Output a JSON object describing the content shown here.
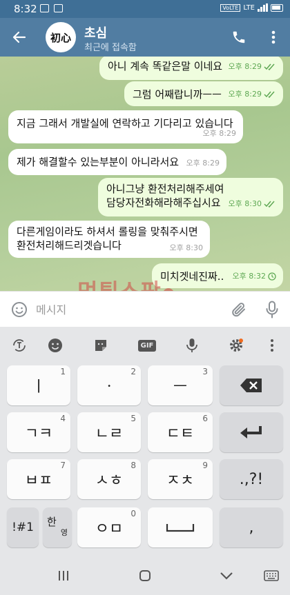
{
  "status_bar": {
    "time": "8:32",
    "network": "LTE"
  },
  "header": {
    "title": "초심",
    "subtitle": "최근에 접속함",
    "avatar_text": "初心"
  },
  "messages": [
    {
      "dir": "out",
      "text": "아니 계속 똑같은말 이네요",
      "time": "오후 8:29",
      "status": "read"
    },
    {
      "dir": "out",
      "text": "그럼 어째랍니까ㅡㅡ",
      "time": "오후 8:29",
      "status": "read"
    },
    {
      "dir": "in",
      "text": "지금 그래서 개발실에 연락하고 기다리고 있습니다",
      "time": "오후 8:29"
    },
    {
      "dir": "in",
      "text": "제가 해결할수 있는부분이 아니라서요",
      "time": "오후 8:29"
    },
    {
      "dir": "out",
      "lines": [
        "아니그냥 환전처리해주세여",
        "담당자전화해라해주십시요"
      ],
      "time": "오후 8:30",
      "status": "read"
    },
    {
      "dir": "in",
      "lines": [
        "다른게임이라도 하셔서 롤링을 맞춰주시면",
        "환전처리해드리겟습니다"
      ],
      "time": "오후 8:30"
    },
    {
      "dir": "out",
      "text": "미치겟네진짜..",
      "time": "오후 8:32",
      "status": "sending"
    }
  ],
  "watermark": "먹튀스팟",
  "input": {
    "placeholder": "메시지"
  },
  "keyboard": {
    "toolbar": {
      "gif_label": "GIF"
    },
    "rows": [
      [
        {
          "label": "ㅣ",
          "num": "1"
        },
        {
          "label": "ㆍ",
          "num": "2"
        },
        {
          "label": "ㅡ",
          "num": "3"
        }
      ],
      [
        {
          "label": "ㄱㅋ",
          "num": "4"
        },
        {
          "label": "ㄴㄹ",
          "num": "5"
        },
        {
          "label": "ㄷㅌ",
          "num": "6"
        }
      ],
      [
        {
          "label": "ㅂㅍ",
          "num": "7"
        },
        {
          "label": "ㅅㅎ",
          "num": "8"
        },
        {
          "label": "ㅈㅊ",
          "num": "9"
        }
      ],
      [
        {
          "label": "ㅇㅁ",
          "num": "0"
        }
      ]
    ],
    "punct_label": ".,?!",
    "symbols_label": "!#1",
    "lang_han": "한",
    "lang_eng": "영",
    "comma_label": ","
  },
  "colors": {
    "header": "#517da2",
    "status_bar": "#3f6f96",
    "outgoing_bubble": "#effdde",
    "incoming_bubble": "#ffffff",
    "read_check": "#5ea853"
  }
}
